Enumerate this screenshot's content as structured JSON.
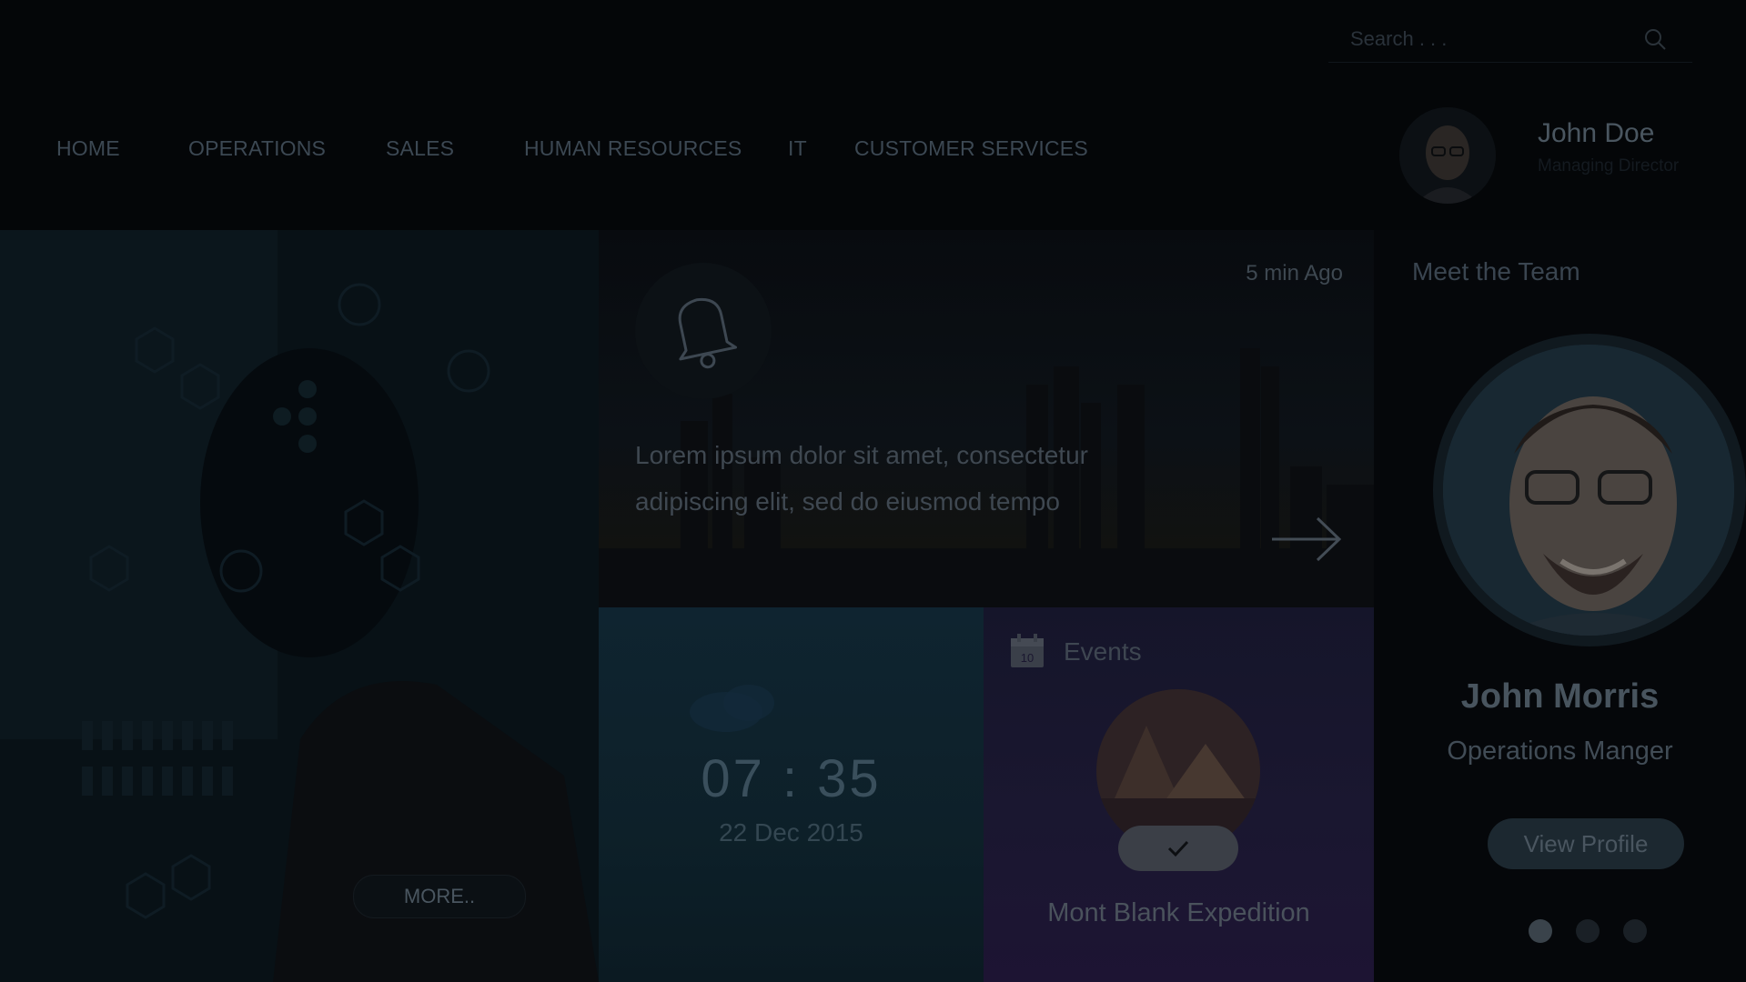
{
  "search": {
    "placeholder": "Search . . ."
  },
  "nav": {
    "items": [
      {
        "label": "HOME"
      },
      {
        "label": "OPERATIONS"
      },
      {
        "label": "SALES"
      },
      {
        "label": "HUMAN RESOURCES"
      },
      {
        "label": "IT"
      },
      {
        "label": "CUSTOMER SERVICES"
      }
    ]
  },
  "user": {
    "name": "John Doe",
    "role": "Managing Director"
  },
  "hero": {
    "more_label": "MORE.."
  },
  "notification": {
    "time": "5 min Ago",
    "text": "Lorem ipsum dolor sit amet, consectetur adipiscing elit, sed do eiusmod tempo",
    "icon": "bell-icon"
  },
  "clock": {
    "time": "07 : 35",
    "date": "22 Dec 2015"
  },
  "events": {
    "title": "Events",
    "calendar_day": "10",
    "name": "Mont Blank Expedition"
  },
  "team": {
    "title": "Meet the Team",
    "member_name": "John Morris",
    "member_role": "Operations Manger",
    "view_profile_label": "View Profile",
    "active_dot": 1
  },
  "colors": {
    "background": "#040608",
    "text": "#4d5963",
    "clock_panel": "#0f2430",
    "events_panel": "#1a1730"
  }
}
